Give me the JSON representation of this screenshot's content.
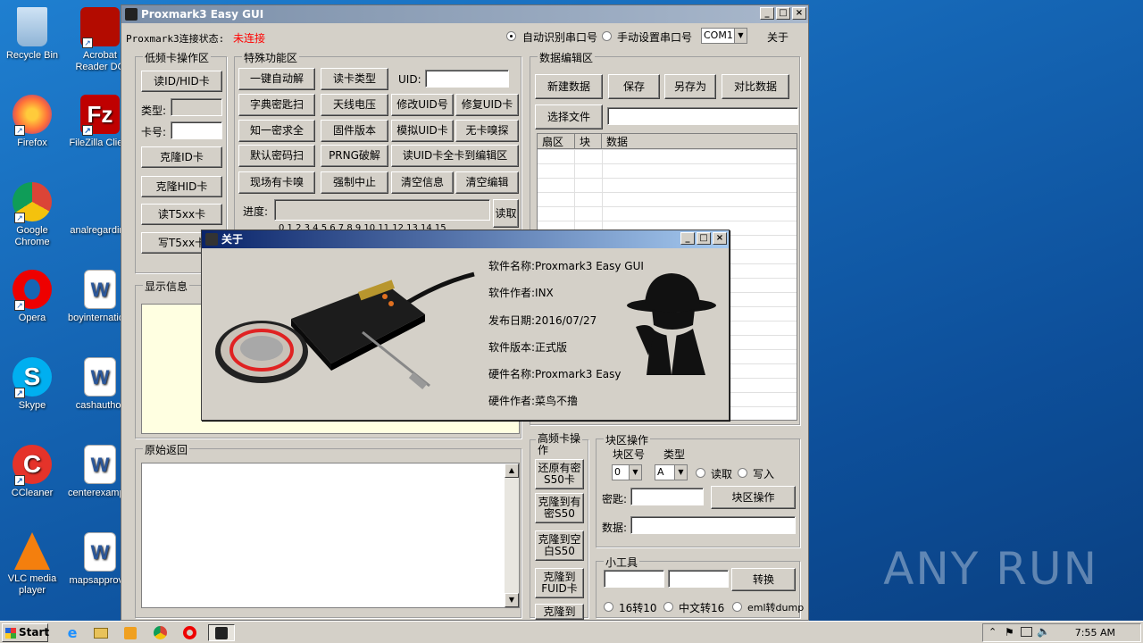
{
  "desktop": {
    "icons": [
      {
        "label": "Recycle Bin",
        "shortcut": false
      },
      {
        "label": "Acrobat Reader DC",
        "shortcut": true
      },
      {
        "label": "Firefox",
        "shortcut": true
      },
      {
        "label": "FileZilla Client",
        "shortcut": true
      },
      {
        "label": "Google Chrome",
        "shortcut": true
      },
      {
        "label": "analregarding",
        "shortcut": false
      },
      {
        "label": "Opera",
        "shortcut": true
      },
      {
        "label": "boyinternational",
        "shortcut": false
      },
      {
        "label": "Skype",
        "shortcut": true
      },
      {
        "label": "cashauthor",
        "shortcut": false
      },
      {
        "label": "CCleaner",
        "shortcut": true
      },
      {
        "label": "centerexample",
        "shortcut": false
      },
      {
        "label": "VLC media player",
        "shortcut": true
      },
      {
        "label": "mapsapproval",
        "shortcut": false
      }
    ],
    "watermark": "ANY RUN"
  },
  "main_window": {
    "title": "Proxmark3 Easy GUI",
    "status_label": "Proxmark3连接状态:",
    "status_value": "未连接",
    "status_color": "#ff0000",
    "radio_auto": "自动识别串口号",
    "radio_manual": "手动设置串口号",
    "port_value": "COM1",
    "about_button": "关于",
    "lf_group": {
      "title": "低频卡操作区",
      "read_id_hid": "读ID/HID卡",
      "type_label": "类型:",
      "card_no_label": "卡号:",
      "clone_id": "克隆ID卡",
      "clone_hid": "克隆HID卡",
      "read_t5": "读T5xx卡",
      "write_t5": "写T5xx卡"
    },
    "special_group": {
      "title": "特殊功能区",
      "buttons": [
        "一键自动解",
        "读卡类型",
        "字典密匙扫",
        "天线电压",
        "修改UID号",
        "修复UID卡",
        "知一密求全",
        "固件版本",
        "模拟UID卡",
        "无卡嗅探",
        "默认密码扫",
        "PRNG破解",
        "读UID卡全卡到编辑区",
        "现场有卡嗅",
        "强制中止",
        "清空信息",
        "清空编辑"
      ],
      "uid_label": "UID:",
      "progress_label": "进度:",
      "read_btn": "读取",
      "sector_nums": "0 1 2 3 4 5 6 7 8 9 10 11 12 13 14 15"
    },
    "display_group": {
      "title": "显示信息"
    },
    "raw_group": {
      "title": "原始返回"
    },
    "data_edit": {
      "title": "数据编辑区",
      "new_btn": "新建数据",
      "save_btn": "保存",
      "save_as_btn": "另存为",
      "compare_btn": "对比数据",
      "choose_file_btn": "选择文件",
      "columns": [
        "扇区",
        "块",
        "数据"
      ]
    },
    "hf_group": {
      "title": "高频卡操作",
      "buttons": [
        "还原有密S50卡",
        "克隆到有密S50",
        "克隆到空白S50",
        "克隆到FUID卡",
        "克隆到"
      ]
    },
    "block_group": {
      "title": "块区操作",
      "block_no_label": "块区号",
      "type_label": "类型",
      "block_value": "0",
      "type_value": "A",
      "read_label": "读取",
      "write_label": "写入",
      "key_label": "密匙:",
      "op_btn": "块区操作",
      "data_label": "数据:"
    },
    "tools_group": {
      "title": "小工具",
      "convert_btn": "转换",
      "opt1": "16转10",
      "opt2": "中文转16",
      "opt3": "eml转dump"
    }
  },
  "about_dialog": {
    "title": "关于",
    "software_name": "软件名称:Proxmark3 Easy GUI",
    "software_author": "软件作者:INX",
    "release_date": "发布日期:2016/07/27",
    "version": "软件版本:正式版",
    "hardware_name": "硬件名称:Proxmark3 Easy",
    "hardware_author": "硬件作者:菜鸟不撸"
  },
  "taskbar": {
    "start_label": "Start",
    "time": "7:55 AM"
  }
}
